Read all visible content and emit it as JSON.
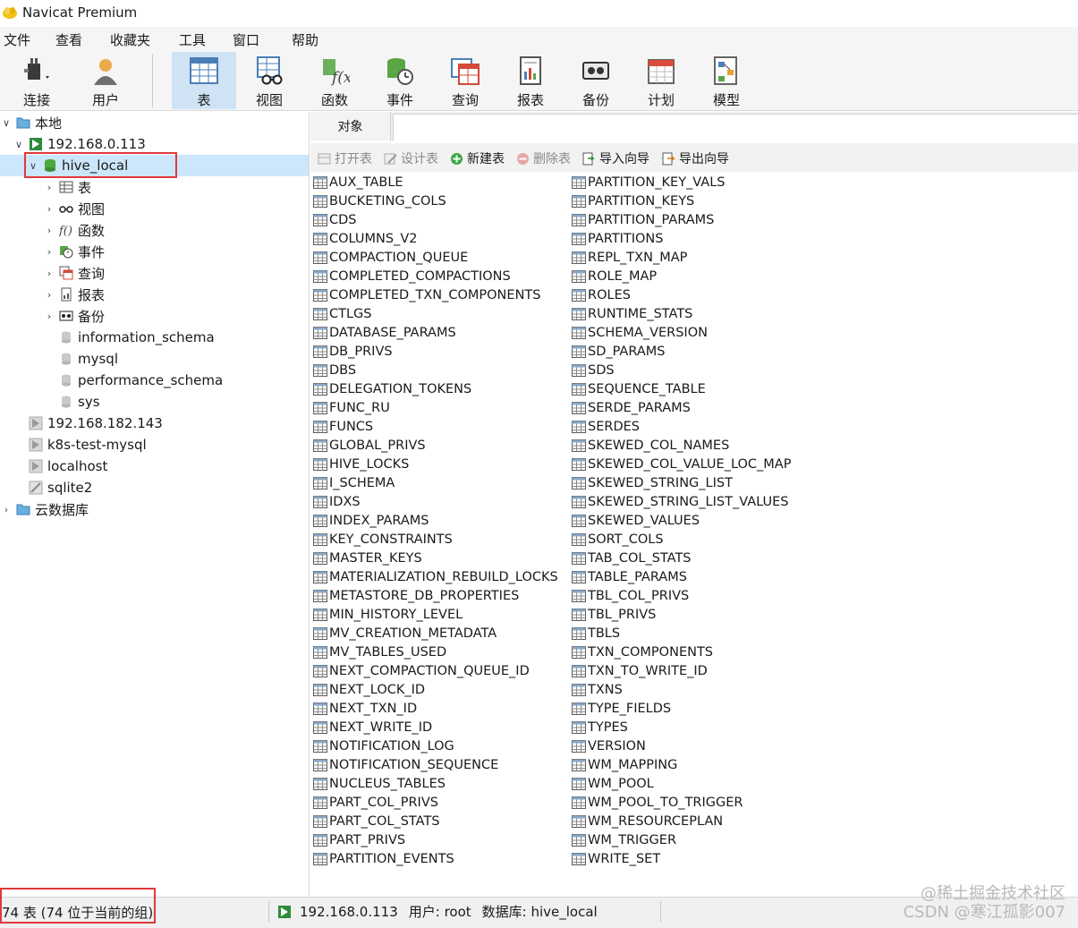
{
  "window": {
    "title": "Navicat Premium"
  },
  "menu": [
    "文件",
    "查看",
    "收藏夹",
    "工具",
    "窗口",
    "帮助"
  ],
  "toolbar": {
    "connect": "连接",
    "user": "用户",
    "table": "表",
    "view": "视图",
    "function": "函数",
    "event": "事件",
    "query": "查询",
    "report": "报表",
    "backup": "备份",
    "schedule": "计划",
    "model": "模型",
    "active": "表"
  },
  "tree": {
    "local": "本地",
    "conn_main": "192.168.0.113",
    "db_selected": "hive_local",
    "db_children": [
      "表",
      "视图",
      "函数",
      "事件",
      "查询",
      "报表",
      "备份"
    ],
    "other_dbs": [
      "information_schema",
      "mysql",
      "performance_schema",
      "sys"
    ],
    "other_conns": [
      "192.168.182.143",
      "k8s-test-mysql",
      "localhost",
      "sqlite2"
    ],
    "cloud": "云数据库"
  },
  "tabs": {
    "objects": "对象"
  },
  "object_toolbar": {
    "open_table": "打开表",
    "design_table": "设计表",
    "new_table": "新建表",
    "delete_table": "删除表",
    "import_wizard": "导入向导",
    "export_wizard": "导出向导"
  },
  "tables_col1": [
    "AUX_TABLE",
    "BUCKETING_COLS",
    "CDS",
    "COLUMNS_V2",
    "COMPACTION_QUEUE",
    "COMPLETED_COMPACTIONS",
    "COMPLETED_TXN_COMPONENTS",
    "CTLGS",
    "DATABASE_PARAMS",
    "DB_PRIVS",
    "DBS",
    "DELEGATION_TOKENS",
    "FUNC_RU",
    "FUNCS",
    "GLOBAL_PRIVS",
    "HIVE_LOCKS",
    "I_SCHEMA",
    "IDXS",
    "INDEX_PARAMS",
    "KEY_CONSTRAINTS",
    "MASTER_KEYS",
    "MATERIALIZATION_REBUILD_LOCKS",
    "METASTORE_DB_PROPERTIES",
    "MIN_HISTORY_LEVEL",
    "MV_CREATION_METADATA",
    "MV_TABLES_USED",
    "NEXT_COMPACTION_QUEUE_ID",
    "NEXT_LOCK_ID",
    "NEXT_TXN_ID",
    "NEXT_WRITE_ID",
    "NOTIFICATION_LOG",
    "NOTIFICATION_SEQUENCE",
    "NUCLEUS_TABLES",
    "PART_COL_PRIVS",
    "PART_COL_STATS",
    "PART_PRIVS",
    "PARTITION_EVENTS"
  ],
  "tables_col2": [
    "PARTITION_KEY_VALS",
    "PARTITION_KEYS",
    "PARTITION_PARAMS",
    "PARTITIONS",
    "REPL_TXN_MAP",
    "ROLE_MAP",
    "ROLES",
    "RUNTIME_STATS",
    "SCHEMA_VERSION",
    "SD_PARAMS",
    "SDS",
    "SEQUENCE_TABLE",
    "SERDE_PARAMS",
    "SERDES",
    "SKEWED_COL_NAMES",
    "SKEWED_COL_VALUE_LOC_MAP",
    "SKEWED_STRING_LIST",
    "SKEWED_STRING_LIST_VALUES",
    "SKEWED_VALUES",
    "SORT_COLS",
    "TAB_COL_STATS",
    "TABLE_PARAMS",
    "TBL_COL_PRIVS",
    "TBL_PRIVS",
    "TBLS",
    "TXN_COMPONENTS",
    "TXN_TO_WRITE_ID",
    "TXNS",
    "TYPE_FIELDS",
    "TYPES",
    "VERSION",
    "WM_MAPPING",
    "WM_POOL",
    "WM_POOL_TO_TRIGGER",
    "WM_RESOURCEPLAN",
    "WM_TRIGGER",
    "WRITE_SET"
  ],
  "status": {
    "count": "74 表 (74 位于当前的组)",
    "connection": "192.168.0.113",
    "user": "用户: root",
    "database": "数据库: hive_local"
  },
  "watermark": [
    "@稀土掘金技术社区",
    "CSDN @寒江孤影007"
  ],
  "colors": {
    "selection": "#cce6fb",
    "highlight_box": "#e0393a",
    "toolbar_active": "#cfe3f5"
  }
}
